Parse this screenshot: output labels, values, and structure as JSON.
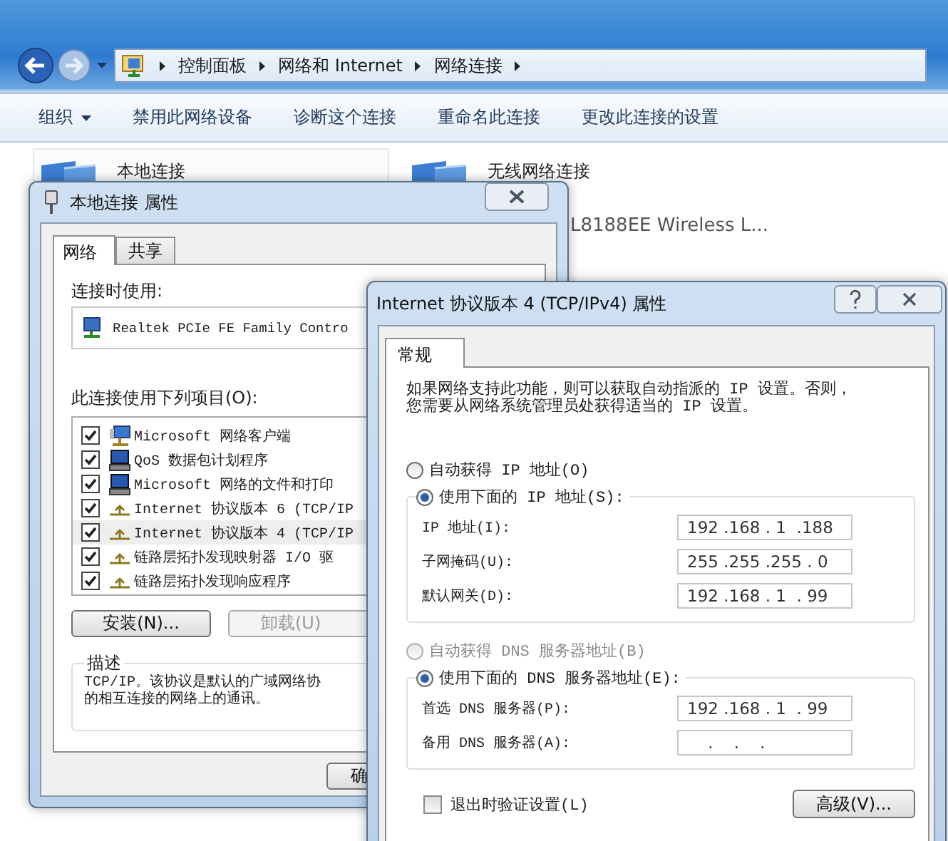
{
  "explorer": {
    "breadcrumb": [
      "控制面板",
      "网络和 Internet",
      "网络连接"
    ],
    "toolbar": [
      {
        "label": "组织",
        "kind": "menu"
      },
      {
        "label": "禁用此网络设备",
        "kind": "button"
      },
      {
        "label": "诊断这个连接",
        "kind": "button"
      },
      {
        "label": "重命名此连接",
        "kind": "button"
      },
      {
        "label": "更改此连接的设置",
        "kind": "button"
      }
    ],
    "connections": [
      {
        "name": "本地连接",
        "selected": true
      },
      {
        "name": "无线网络连接",
        "selected": false,
        "detail": "L8188EE Wireless L..."
      }
    ]
  },
  "local_properties": {
    "title": "本地连接 属性",
    "tabs": [
      {
        "label": "网络",
        "selected": true
      },
      {
        "label": "共享",
        "selected": false
      }
    ],
    "connect_using_label": "连接时使用:",
    "adapter": "Realtek PCIe FE Family Contro",
    "items_label": "此连接使用下列项目(O):",
    "items": [
      {
        "label": "Microsoft 网络客户端",
        "checked": true,
        "selected": false,
        "kind": "client"
      },
      {
        "label": "QoS 数据包计划程序",
        "checked": true,
        "selected": false,
        "kind": "service"
      },
      {
        "label": "Microsoft 网络的文件和打印",
        "checked": true,
        "selected": false,
        "kind": "service"
      },
      {
        "label": "Internet 协议版本 6 (TCP/IP",
        "checked": true,
        "selected": false,
        "kind": "protocol"
      },
      {
        "label": "Internet 协议版本 4 (TCP/IP",
        "checked": true,
        "selected": true,
        "kind": "protocol"
      },
      {
        "label": "链路层拓扑发现映射器 I/O 驱",
        "checked": true,
        "selected": false,
        "kind": "protocol"
      },
      {
        "label": "链路层拓扑发现响应程序",
        "checked": true,
        "selected": false,
        "kind": "protocol"
      }
    ],
    "buttons": [
      {
        "label": "安装(N)...",
        "disabled": false
      },
      {
        "label": "卸载(U)",
        "disabled": true
      }
    ],
    "description_title": "描述",
    "description": [
      "TCP/IP。该协议是默认的广域网络协",
      "的相互连接的网络上的通讯。"
    ],
    "ok_button": "确"
  },
  "ipv4": {
    "title": "Internet 协议版本 4 (TCP/IPv4) 属性",
    "tabs": [
      {
        "label": "常规",
        "selected": true
      }
    ],
    "intro": [
      "如果网络支持此功能，则可以获取自动指派的 IP 设置。否则，",
      "您需要从网络系统管理员处获得适当的 IP 设置。"
    ],
    "ip_mode": [
      {
        "label": "自动获得 IP 地址(O)",
        "selected": false,
        "disabled": false
      },
      {
        "label": "使用下面的 IP 地址(S):",
        "selected": true,
        "disabled": false
      }
    ],
    "ip_fields": [
      {
        "label": "IP 地址(I):",
        "value": "192 .168 . 1  .188"
      },
      {
        "label": "子网掩码(U):",
        "value": "255 .255 .255 . 0"
      },
      {
        "label": "默认网关(D):",
        "value": "192 .168 . 1  . 99"
      }
    ],
    "dns_mode": [
      {
        "label": "自动获得 DNS 服务器地址(B)",
        "selected": false,
        "disabled": true
      },
      {
        "label": "使用下面的 DNS 服务器地址(E):",
        "selected": true,
        "disabled": false
      }
    ],
    "dns_fields": [
      {
        "label": "首选 DNS 服务器(P):",
        "value": "192 .168 . 1  . 99"
      },
      {
        "label": "备用 DNS 服务器(A):",
        "value": "    .    .    ."
      }
    ],
    "verify_on_exit": {
      "label": "退出时验证设置(L)",
      "checked": false
    },
    "advanced_button": "高级(V)..."
  }
}
